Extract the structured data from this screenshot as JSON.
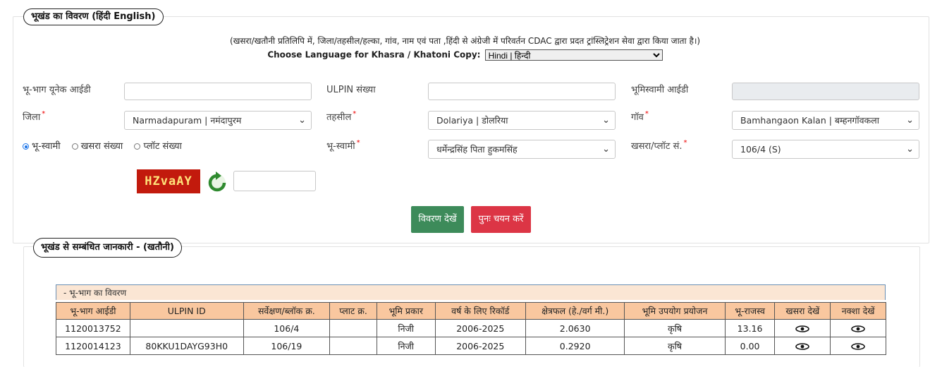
{
  "section1": {
    "legend": "भूखंड का विवरण  (हिंदी   English)",
    "note": "(खसरा/खतौनी प्रतिलिपि में, जिला/तहसील/हल्का, गांव, नाम एवं पता ,हिंदी से अंग्रेजी में परिवर्तन CDAC द्वारा प्रदत ट्रांस्लिट्रेशन सेवा द्वारा किया जाता है।)",
    "language_label": "Choose Language for Khasra / Khatoni Copy:",
    "language_value": "Hindi | हिन्दी"
  },
  "form": {
    "unique_id_label": "भू-भाग यूनेक आईडी",
    "unique_id_value": "",
    "ulpin_label": "ULPIN संख्या",
    "ulpin_value": "",
    "owner_id_label": "भूमिस्वामी आईडी",
    "owner_id_value": "",
    "district_label": "जिला",
    "district_value": "Narmadapuram | नमंदापुरम",
    "tehsil_label": "तहसील",
    "tehsil_value": "Dolariya | डोलरिया",
    "village_label": "गॉव",
    "village_value": "Bamhangaon Kalan | बम्हनगॉवकला",
    "radio_owner": "भू-स्वामी",
    "radio_khasra": "खसरा संख्या",
    "radio_plot": "प्लॉट संख्या",
    "owner_label": "भू-स्वामी",
    "owner_value": "धर्मेन्द्रसिंह पिता हुकमसिंह",
    "khasra_label": "खसरा/प्लॉट सं.",
    "khasra_value": "106/4 (S)",
    "required_mark": "*",
    "captcha_text": "HZvaAY",
    "captcha_input": "",
    "view_button": "विवरण देखें",
    "reset_button": "पुनः चयन करें"
  },
  "section2": {
    "legend": "भूखंड से सम्बंधित जानकारी -   (खतौनी)",
    "table_caption": "- भू-भाग का विवरण",
    "headers": [
      "भू-भाग आईडी",
      "ULPIN ID",
      "सर्वेक्षण/ब्लॉक क्र.",
      "प्लाट क्र.",
      "भूमि प्रकार",
      "वर्ष के लिए रिकॉर्ड",
      "क्षेत्रफल (हे./वर्ग मी.)",
      "भूमि उपयोग प्रयोजन",
      "भू-राजस्व",
      "खसरा देखें",
      "नक्शा देखें"
    ],
    "rows": [
      [
        "1120013752",
        "",
        "106/4",
        "",
        "निजी",
        "2006-2025",
        "2.0630",
        "कृषि",
        "13.16"
      ],
      [
        "1120014123",
        "80KKU1DAYG93H0",
        "106/19",
        "",
        "निजी",
        "2006-2025",
        "0.2920",
        "कृषि",
        "0.00"
      ]
    ]
  },
  "colors": {
    "header_bg": "#f9c79f",
    "view_button": "#3d8b5a",
    "reset_button": "#dc3545",
    "captcha_bg": "#c21a0d"
  }
}
